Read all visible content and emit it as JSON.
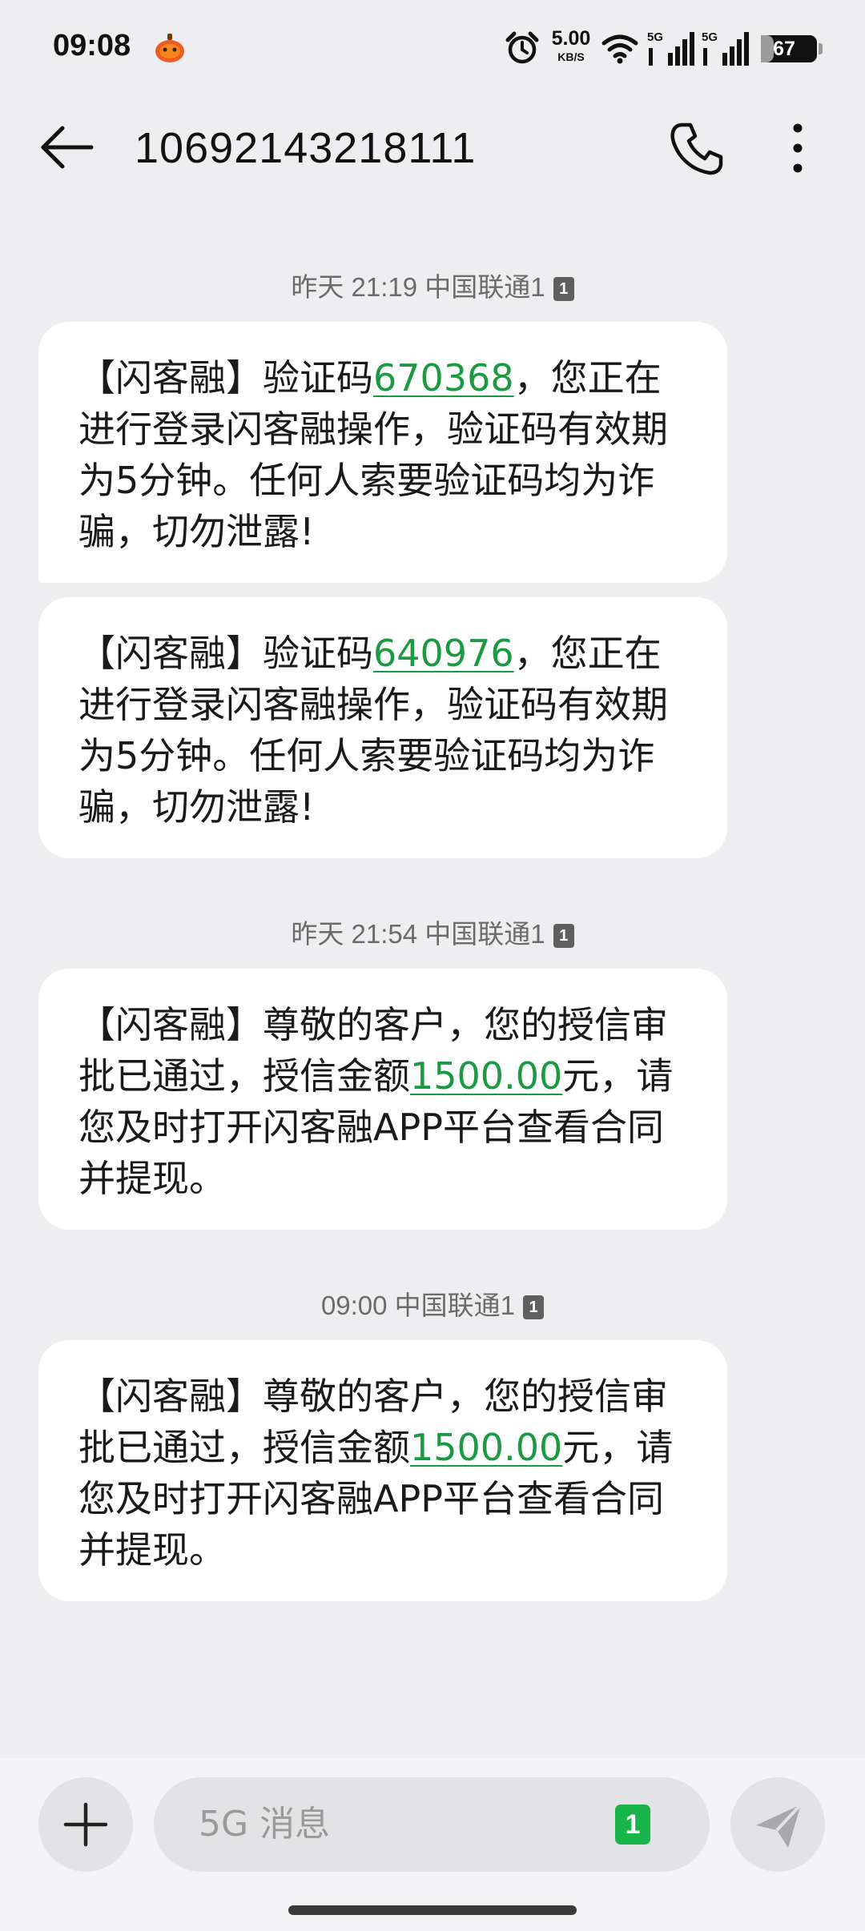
{
  "status_bar": {
    "time": "09:08",
    "net_speed_value": "5.00",
    "net_speed_unit": "KB/S",
    "signal1_label": "5G",
    "signal2_label": "5G",
    "battery": "67",
    "icons": [
      "app-notification-icon",
      "alarm-icon",
      "wifi-icon",
      "signal-icon",
      "battery-icon"
    ]
  },
  "header": {
    "title": "10692143218111",
    "back_icon": "arrow-left-icon",
    "call_icon": "phone-icon",
    "more_icon": "more-vertical-icon"
  },
  "conversation": {
    "groups": [
      {
        "timestamp": "昨天 21:19 中国联通1",
        "sim": "1",
        "messages": [
          {
            "before": "【闪客融】验证码",
            "highlight": "670368",
            "after": "，您正在进行登录闪客融操作，验证码有效期为5分钟。任何人索要验证码均为诈骗，切勿泄露!"
          },
          {
            "before": "【闪客融】验证码",
            "highlight": "640976",
            "after": "，您正在进行登录闪客融操作，验证码有效期为5分钟。任何人索要验证码均为诈骗，切勿泄露!"
          }
        ]
      },
      {
        "timestamp": "昨天 21:54 中国联通1",
        "sim": "1",
        "messages": [
          {
            "before": "【闪客融】尊敬的客户，您的授信审批已通过，授信金额",
            "highlight": "1500.00",
            "after": "元，请您及时打开闪客融APP平台查看合同并提现。"
          }
        ]
      },
      {
        "timestamp": "09:00 中国联通1",
        "sim": "1",
        "messages": [
          {
            "before": "【闪客融】尊敬的客户，您的授信审批已通过，授信金额",
            "highlight": "1500.00",
            "after": "元，请您及时打开闪客融APP平台查看合同并提现。"
          }
        ]
      }
    ]
  },
  "composer": {
    "placeholder": "5G 消息",
    "sim_badge": "1",
    "add_icon": "plus-icon",
    "send_icon": "send-icon"
  },
  "colors": {
    "background": "#eeeef0",
    "bubble": "#ffffff",
    "highlight": "#1b9a41",
    "sim_badge": "#19b54a"
  }
}
